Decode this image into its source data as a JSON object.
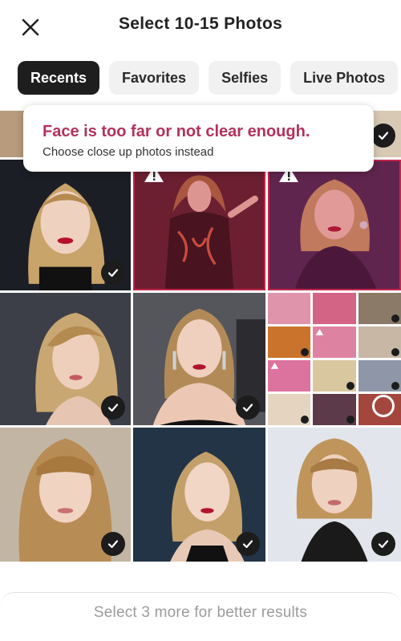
{
  "header": {
    "title": "Select 10-15 Photos"
  },
  "tabs": [
    {
      "label": "Recents"
    },
    {
      "label": "Favorites"
    },
    {
      "label": "Selfies"
    },
    {
      "label": "Live Photos"
    }
  ],
  "toast": {
    "title": "Face is too far or not clear enough.",
    "subtitle": "Choose close up photos instead",
    "title_color": "#b3325a"
  },
  "photos": [
    {
      "state": "selected"
    },
    {
      "state": "warning"
    },
    {
      "state": "warning"
    },
    {
      "state": "selected"
    },
    {
      "state": "selected"
    },
    {
      "state": "collage"
    },
    {
      "state": "selected"
    },
    {
      "state": "selected"
    },
    {
      "state": "selected"
    }
  ],
  "bottom": {
    "hint": "Select 3 more for better results"
  },
  "colors": {
    "accent": "#1e1e1e",
    "warning": "#c1264a"
  },
  "icons": [
    "close-icon",
    "checkmark-icon",
    "warning-icon",
    "selection-ring-icon"
  ]
}
